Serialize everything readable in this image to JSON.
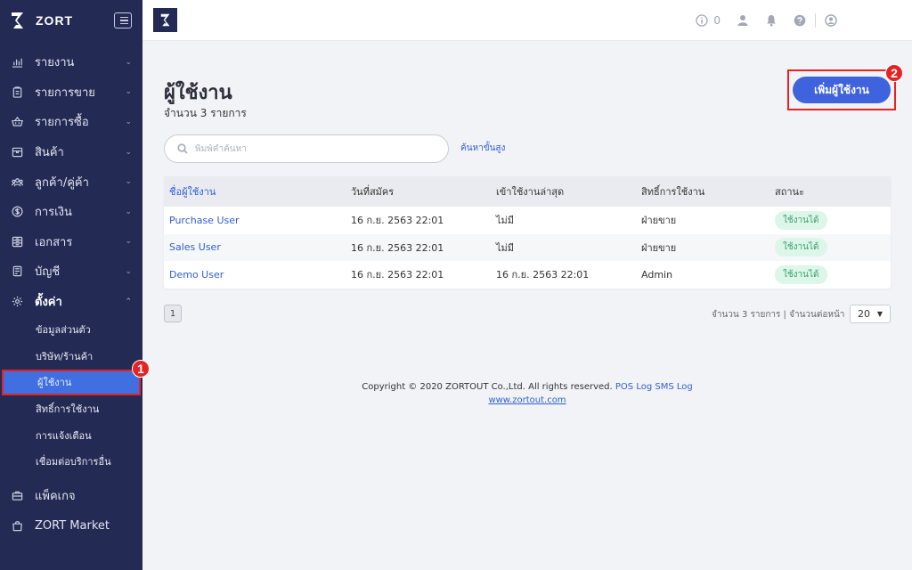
{
  "brand": {
    "name": "ZORT"
  },
  "sidebar": {
    "items": [
      {
        "label": "รายงาน",
        "icon": "chart-icon"
      },
      {
        "label": "รายการขาย",
        "icon": "clipboard-icon"
      },
      {
        "label": "รายการซื้อ",
        "icon": "basket-icon"
      },
      {
        "label": "สินค้า",
        "icon": "box-icon"
      },
      {
        "label": "ลูกค้า/คู่ค้า",
        "icon": "people-icon"
      },
      {
        "label": "การเงิน",
        "icon": "dollar-icon"
      },
      {
        "label": "เอกสาร",
        "icon": "document-icon"
      },
      {
        "label": "บัญชี",
        "icon": "ledger-icon"
      },
      {
        "label": "ตั้งค่า",
        "icon": "gear-icon"
      }
    ],
    "settings_sub": [
      {
        "label": "ข้อมูลส่วนตัว"
      },
      {
        "label": "บริษัท/ร้านค้า"
      },
      {
        "label": "ผู้ใช้งาน"
      },
      {
        "label": "สิทธิ์การใช้งาน"
      },
      {
        "label": "การแจ้งเตือน"
      },
      {
        "label": "เชื่อมต่อบริการอื่น"
      }
    ],
    "bottom": [
      {
        "label": "แพ็คเกจ",
        "icon": "briefcase-icon"
      },
      {
        "label": "ZORT Market",
        "icon": "shopping-bag-icon"
      }
    ]
  },
  "annotations": {
    "one": "1",
    "two": "2"
  },
  "topbar": {
    "notification_count": "0"
  },
  "page": {
    "title": "ผู้ใช้งาน",
    "count": "จำนวน 3 รายการ",
    "add_button": "เพิ่มผู้ใช้งาน"
  },
  "search": {
    "placeholder": "พิมพ์คำค้นหา",
    "advanced": "ค้นหาขั้นสูง"
  },
  "table": {
    "headers": [
      "ชื่อผู้ใช้งาน",
      "วันที่สมัคร",
      "เข้าใช้งานล่าสุด",
      "สิทธิ์การใช้งาน",
      "สถานะ"
    ],
    "rows": [
      [
        "Purchase User",
        "16 ก.ย. 2563 22:01",
        "ไม่มี",
        "ฝ่ายขาย",
        "ใช้งานได้"
      ],
      [
        "Sales User",
        "16 ก.ย. 2563 22:01",
        "ไม่มี",
        "ฝ่ายขาย",
        "ใช้งานได้"
      ],
      [
        "Demo User",
        "16 ก.ย. 2563 22:01",
        "16 ก.ย. 2563 22:01",
        "Admin",
        "ใช้งานได้"
      ]
    ]
  },
  "pagination": {
    "page": "1",
    "summary": "จำนวน 3 รายการ | จำนวนต่อหน้า",
    "per_page": "20"
  },
  "footer": {
    "copyright": "Copyright © 2020 ZORTOUT Co.,Ltd. All rights reserved.",
    "pos": "POS",
    "log": "Log",
    "sms_log": "SMS Log",
    "website": "www.zortout.com"
  },
  "colors": {
    "sidebar": "#232a54",
    "accent": "#3f62dd",
    "highlight": "#e52323",
    "active_item": "#3f6fe0"
  }
}
